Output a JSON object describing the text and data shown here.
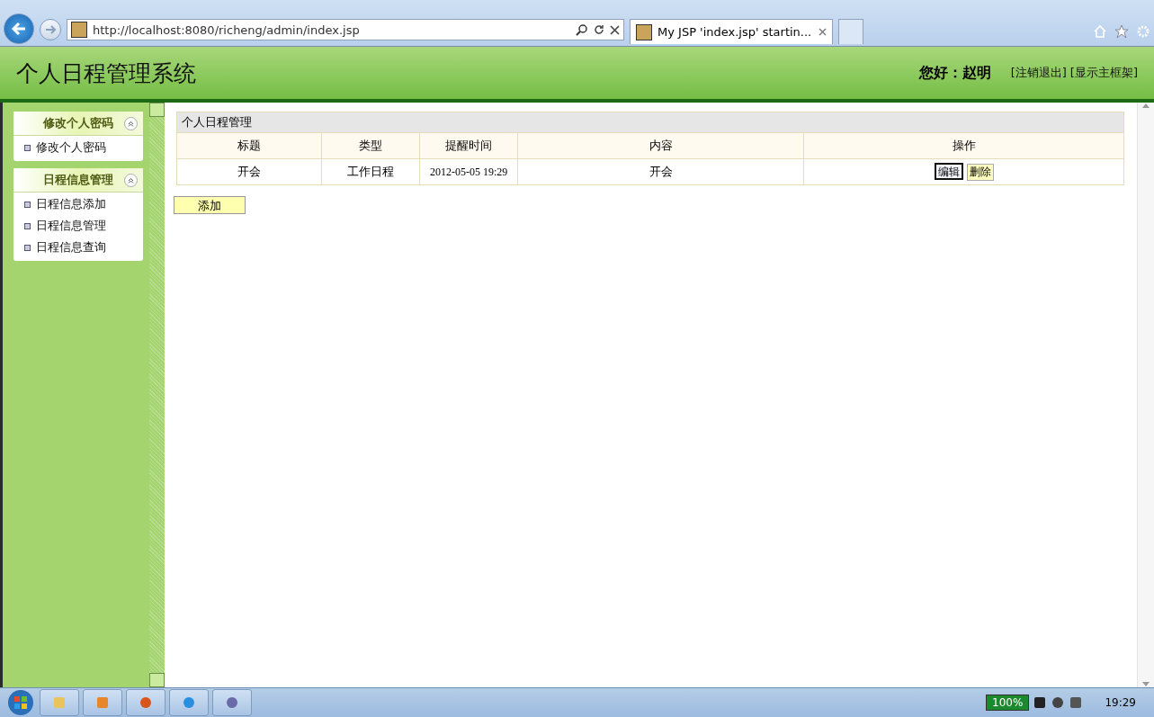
{
  "browser": {
    "address": "http://localhost:8080/richeng/admin/index.jsp",
    "tabs": [
      {
        "label": "My JSP 'index.jsp' startin...",
        "selected": true
      }
    ]
  },
  "header": {
    "title": "个人日程管理系统",
    "greeting": "您好：赵明",
    "links": [
      "[注销退出]",
      "[显示主框架]"
    ]
  },
  "sidebar": {
    "groups": [
      {
        "title": "修改个人密码",
        "expanded": true,
        "items": [
          "修改个人密码"
        ]
      },
      {
        "title": "日程信息管理",
        "expanded": true,
        "items": [
          "日程信息添加",
          "日程信息管理",
          "日程信息查询"
        ]
      }
    ]
  },
  "panel": {
    "title": "个人日程管理",
    "columns": [
      "标题",
      "类型",
      "提醒时间",
      "内容",
      "操作"
    ],
    "rows": [
      {
        "cells": [
          "开会",
          "工作日程",
          "2012-05-05 19:29",
          "开会"
        ],
        "actions": [
          {
            "label": "编辑",
            "focused": true
          },
          {
            "label": "删除",
            "focused": false
          }
        ]
      }
    ],
    "add_button": "添加"
  },
  "taskbar": {
    "battery": "100%",
    "clock": "19:29"
  }
}
